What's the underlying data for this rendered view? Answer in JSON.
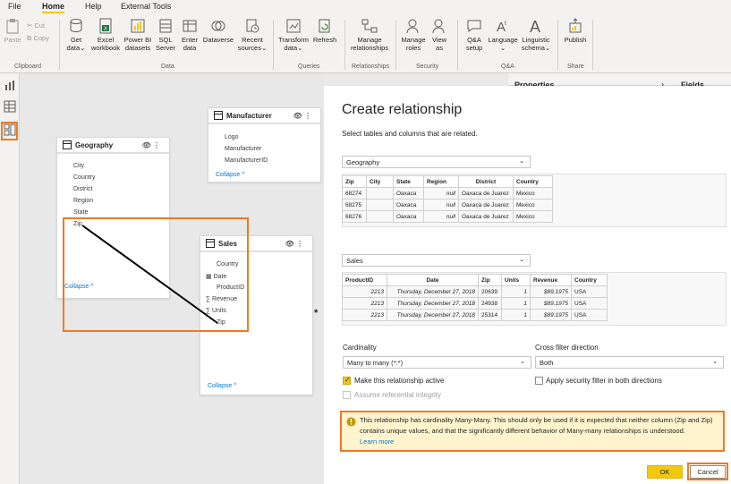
{
  "menu": {
    "file": "File",
    "home": "Home",
    "help": "Help",
    "external": "External Tools"
  },
  "ribbon": {
    "clipboard": {
      "paste": "Paste",
      "cut": "Cut",
      "copy": "Copy",
      "group": "Clipboard"
    },
    "data": {
      "get_data": "Get data",
      "excel": "Excel workbook",
      "pbi": "Power BI datasets",
      "sql": "SQL Server",
      "enter": "Enter data",
      "dataverse": "Dataverse",
      "recent": "Recent sources",
      "group": "Data"
    },
    "queries": {
      "transform": "Transform data",
      "refresh": "Refresh",
      "group": "Queries"
    },
    "relationships": {
      "manage": "Manage relationships",
      "group": "Relationships"
    },
    "security": {
      "roles": "Manage roles",
      "view_as": "View as",
      "group": "Security"
    },
    "qa": {
      "setup": "Q&A setup",
      "language": "Language",
      "schema": "Linguistic schema",
      "group": "Q&A"
    },
    "share": {
      "publish": "Publish",
      "group": "Share"
    }
  },
  "panes": {
    "properties": "Properties",
    "fields": "Fields"
  },
  "model": {
    "geography": {
      "title": "Geography",
      "fields": [
        "City",
        "Country",
        "District",
        "Region",
        "State",
        "Zip"
      ],
      "collapse": "Collapse"
    },
    "manufacturer": {
      "title": "Manufacturer",
      "fields": [
        "Logo",
        "Manufacturer",
        "ManufacturerID"
      ],
      "collapse": "Collapse"
    },
    "sales": {
      "title": "Sales",
      "fields": [
        "Country",
        "Date",
        "ProductID",
        "Revenue",
        "Units",
        "Zip"
      ],
      "collapse": "Collapse"
    },
    "cardinality_marker": "*"
  },
  "dialog": {
    "title": "Create relationship",
    "subtitle": "Select tables and columns that are related.",
    "table1": {
      "name": "Geography",
      "headers": [
        "Zip",
        "City",
        "State",
        "Region",
        "District",
        "Country"
      ],
      "rows": [
        [
          "68274",
          "",
          "Oaxaca",
          "null",
          "Oaxaca de Juarez",
          "Mexico"
        ],
        [
          "68275",
          "",
          "Oaxaca",
          "null",
          "Oaxaca de Juarez",
          "Mexico"
        ],
        [
          "68276",
          "",
          "Oaxaca",
          "null",
          "Oaxaca de Juarez",
          "Mexico"
        ]
      ]
    },
    "table2": {
      "name": "Sales",
      "headers": [
        "ProductID",
        "Date",
        "Zip",
        "Units",
        "Revenue",
        "Country"
      ],
      "rows": [
        [
          "2213",
          "Thursday, December 27, 2018",
          "20639",
          "1",
          "$89.1975",
          "USA"
        ],
        [
          "2213",
          "Thursday, December 27, 2018",
          "24938",
          "1",
          "$89.1975",
          "USA"
        ],
        [
          "2213",
          "Thursday, December 27, 2018",
          "25314",
          "1",
          "$89.1975",
          "USA"
        ]
      ]
    },
    "cardinality_label": "Cardinality",
    "cardinality_value": "Many to many (*:*)",
    "crossfilter_label": "Cross filter direction",
    "crossfilter_value": "Both",
    "active_label": "Make this relationship active",
    "referential_label": "Assume referential integrity",
    "security_label": "Apply security filter in both directions",
    "warning_text": "This relationship has cardinality Many-Many. This should only be used if it is expected that neither column (Zip and Zip) contains unique values, and that the significantly different behavior of Many-many relationships is understood.",
    "learn_more": "Learn more",
    "ok": "OK",
    "cancel": "Cancel"
  },
  "colors": {
    "accent": "#f2c811",
    "highlight": "#f2791e",
    "link": "#0078d4"
  }
}
